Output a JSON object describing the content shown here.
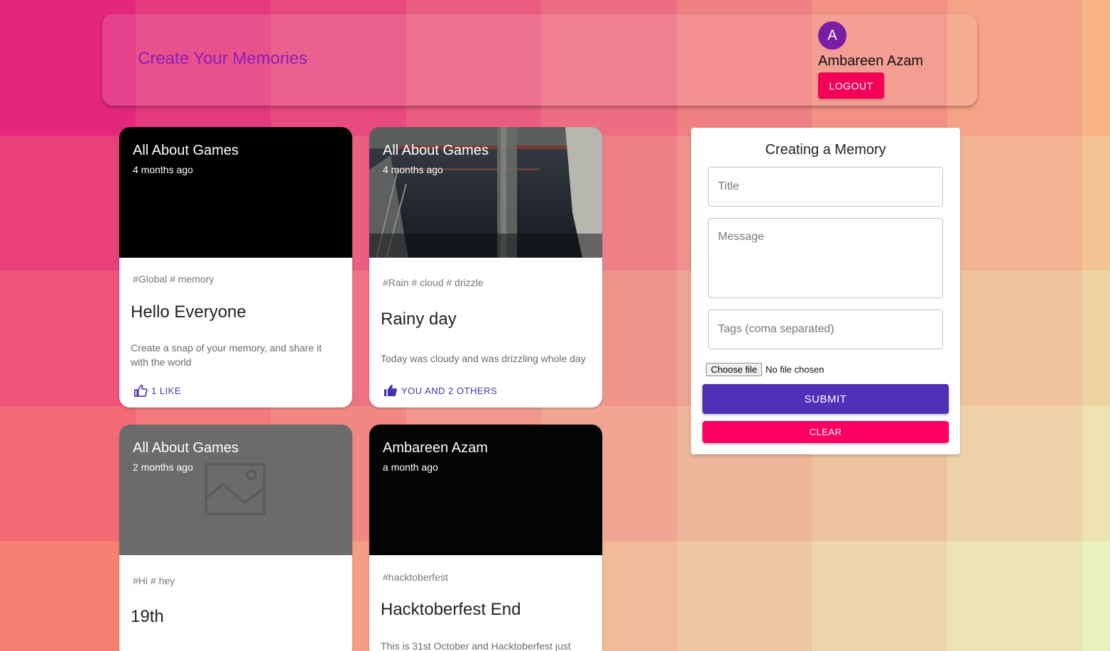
{
  "background": {
    "columns": 9,
    "rows": 5,
    "corner_colors": {
      "top_left": "#e3287c",
      "top_right": "#f6b487",
      "bottom_left": "#f88073",
      "bottom_right": "#eaf2bc"
    }
  },
  "header": {
    "title": "Create Your Memories",
    "user_initial": "A",
    "user_name": "Ambareen Azam",
    "logout_label": "LOGOUT"
  },
  "posts": [
    {
      "author": "All About Games",
      "time": "4 months ago",
      "tags": "#Global # memory",
      "title": "Hello Everyone",
      "message": "Create a snap of your memory, and share it with the world",
      "likes_label": "1 LIKE",
      "liked": false,
      "media": "dark"
    },
    {
      "author": "All About Games",
      "time": "4 months ago",
      "tags": "#Rain # cloud # drizzle",
      "title": "Rainy day",
      "message": "Today was cloudy and was drizzling whole day",
      "likes_label": "YOU AND 2 OTHERS",
      "liked": true,
      "media": "photo"
    },
    {
      "author": "All About Games",
      "time": "2 months ago",
      "tags": "#Hi # hey",
      "title": "19th",
      "message": "",
      "likes_label": "",
      "liked": false,
      "media": "placeholder"
    },
    {
      "author": "Ambareen Azam",
      "time": "a month ago",
      "tags": "#hacktoberfest",
      "title": "Hacktoberfest End",
      "message": "This is 31st October and Hacktoberfest just",
      "likes_label": "",
      "liked": false,
      "media": "dark"
    }
  ],
  "form": {
    "heading": "Creating a Memory",
    "title_placeholder": "Title",
    "message_placeholder": "Message",
    "tags_placeholder": "Tags (coma separated)",
    "file_button_label": "Choose file",
    "file_status": "No file chosen",
    "submit_label": "SUBMIT",
    "clear_label": "CLEAR"
  },
  "colors": {
    "title_purple": "#8d1fb8",
    "avatar_purple": "#7b1fa2",
    "accent_pink": "#f50057",
    "primary_indigo": "#5130b8",
    "like_indigo": "#4a30b0"
  }
}
